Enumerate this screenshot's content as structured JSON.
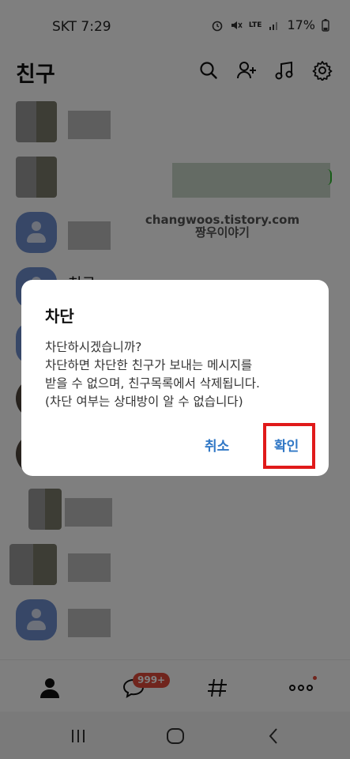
{
  "status_bar": {
    "carrier_time": "SKT 7:29",
    "battery": "17%",
    "network": "LTE"
  },
  "header": {
    "title": "친구"
  },
  "list": {
    "watermark_line1": "changwoos.tistory.com",
    "watermark_line2": "짱우이야기",
    "visible_friend_name": "친구"
  },
  "dialog": {
    "title": "차단",
    "body_lines": [
      "차단하시겠습니까?",
      "차단하면 차단한 친구가 보내는 메시지를",
      "받을 수 없으며, 친구목록에서 삭제됩니다.",
      "(차단 여부는 상대방이 알 수 없습니다)"
    ],
    "cancel_label": "취소",
    "confirm_label": "확인"
  },
  "bottom_nav": {
    "chat_badge": "999+"
  },
  "colors": {
    "accent": "#3178c6",
    "highlight_box": "#e01a1a",
    "badge": "#e04b3a"
  }
}
